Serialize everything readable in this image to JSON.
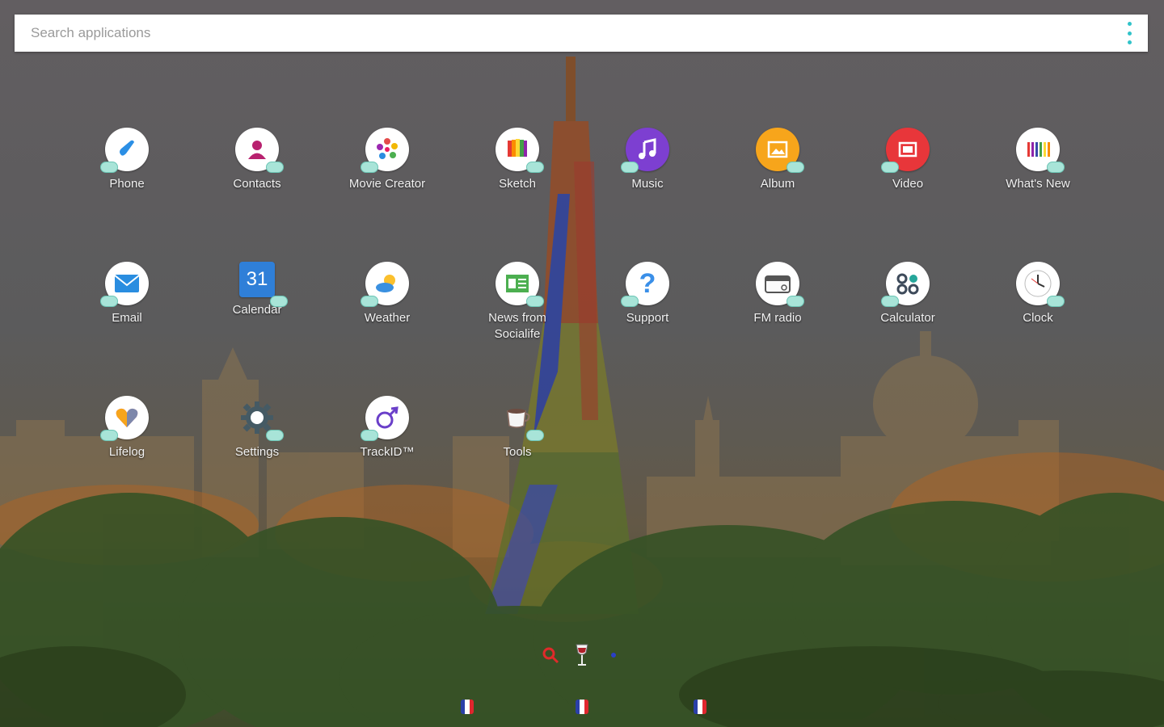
{
  "search": {
    "placeholder": "Search applications"
  },
  "colors": {
    "accent": "#31c3c9",
    "label_text": "#f2f2f2",
    "search_bg": "#ffffff"
  },
  "apps": [
    {
      "label": "Phone",
      "icon": "phone-icon",
      "color": "#ffffff",
      "glyph_color": "#2b8fe5"
    },
    {
      "label": "Contacts",
      "icon": "contacts-icon",
      "color": "#ffffff",
      "glyph_color": "#b8216f"
    },
    {
      "label": "Movie Creator",
      "icon": "movie-creator-icon",
      "color": "#ffffff",
      "glyph_color": "#e34b4b"
    },
    {
      "label": "Sketch",
      "icon": "sketch-icon",
      "color": "#ffffff",
      "glyph_color": "#f2b705"
    },
    {
      "label": "Music",
      "icon": "music-icon",
      "color": "#7d3fd1",
      "glyph_color": "#ffffff"
    },
    {
      "label": "Album",
      "icon": "album-icon",
      "color": "#f7a51b",
      "glyph_color": "#ffffff"
    },
    {
      "label": "Video",
      "icon": "video-icon",
      "color": "#e8363a",
      "glyph_color": "#ffffff"
    },
    {
      "label": "What's New",
      "icon": "whats-new-icon",
      "color": "#ffffff",
      "glyph_color": "#c2185b"
    },
    {
      "label": "Email",
      "icon": "email-icon",
      "color": "#ffffff",
      "glyph_color": "#2a8de0"
    },
    {
      "label": "Calendar",
      "icon": "calendar-icon",
      "color": "#2f7fd8",
      "glyph_color": "#ffffff",
      "glyph_text": "31"
    },
    {
      "label": "Weather",
      "icon": "weather-icon",
      "color": "#ffffff",
      "glyph_color": "#3a90e0"
    },
    {
      "label": "News from Socialife",
      "icon": "news-icon",
      "color": "#ffffff",
      "glyph_color": "#4caf50"
    },
    {
      "label": "Support",
      "icon": "support-icon",
      "color": "#ffffff",
      "glyph_color": "#3a8fe8",
      "glyph_text": "?"
    },
    {
      "label": "FM radio",
      "icon": "fm-radio-icon",
      "color": "#ffffff",
      "glyph_color": "#555555"
    },
    {
      "label": "Calculator",
      "icon": "calculator-icon",
      "color": "#ffffff",
      "glyph_color": "#3d4a5a"
    },
    {
      "label": "Clock",
      "icon": "clock-icon",
      "color": "#ffffff",
      "glyph_color": "#333333"
    },
    {
      "label": "Lifelog",
      "icon": "lifelog-icon",
      "color": "#ffffff",
      "glyph_color": "#e04a7a"
    },
    {
      "label": "Settings",
      "icon": "settings-gear-icon",
      "color": "#ffffff",
      "glyph_color": "#455a64"
    },
    {
      "label": "TrackID™",
      "icon": "trackid-icon",
      "color": "#ffffff",
      "glyph_color": "#6a3fc9"
    },
    {
      "label": "Tools",
      "icon": "tools-coffee-icon",
      "color": "#ffffff",
      "glyph_color": "#8d6e63"
    }
  ],
  "dock": {
    "items": [
      "search-icon",
      "wine-glass-icon",
      "dot-icon"
    ],
    "flags": [
      "french-flag-icon",
      "french-flag-icon",
      "french-flag-icon"
    ]
  }
}
